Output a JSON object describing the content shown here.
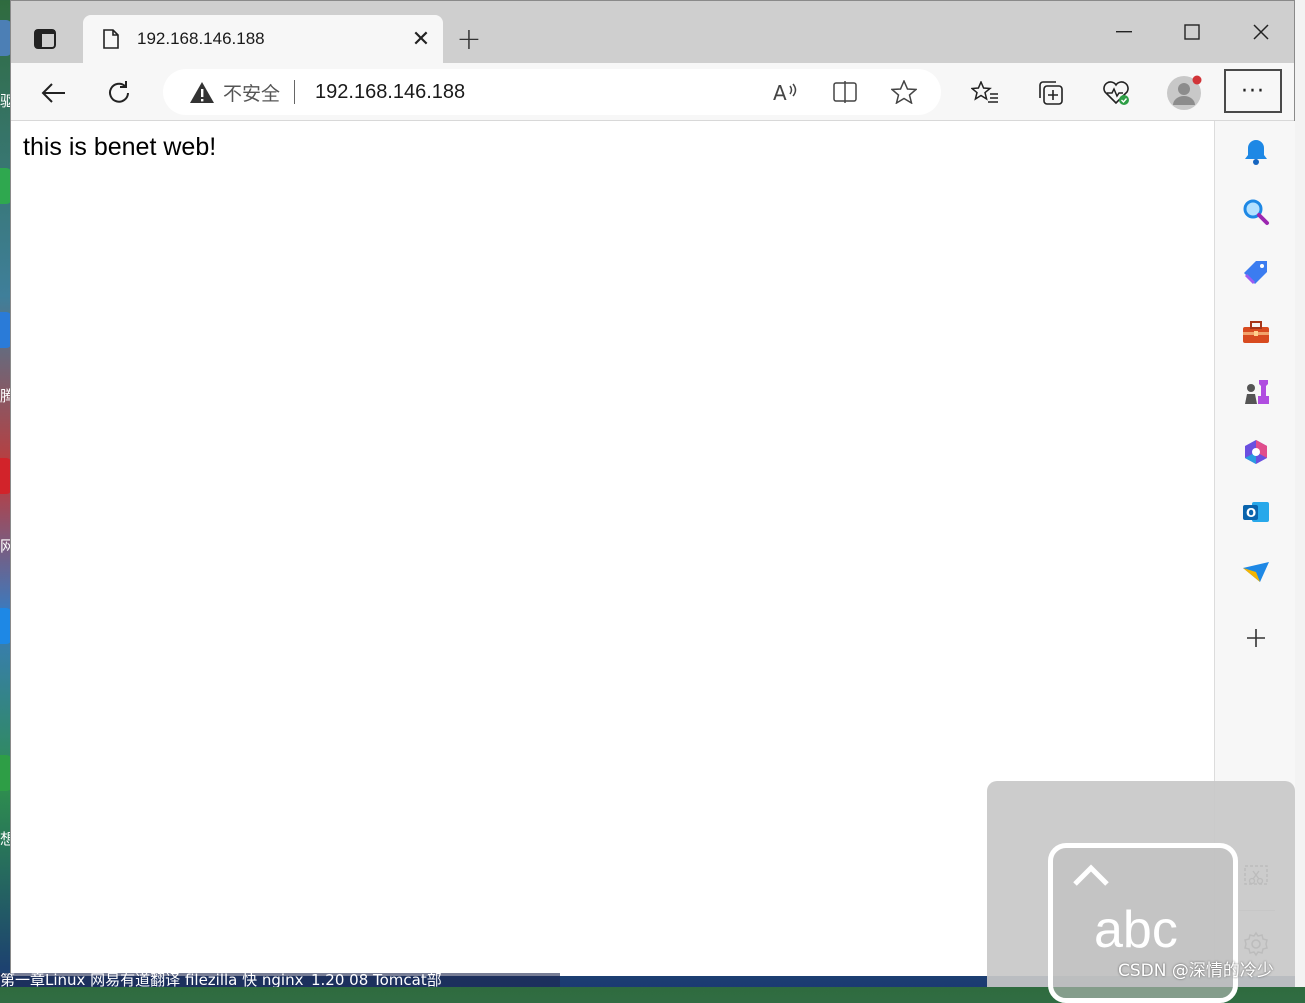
{
  "browser": {
    "tab": {
      "title": "192.168.146.188",
      "close_glyph": "✕"
    },
    "new_tab_glyph": "+",
    "window_controls": {
      "minimize": "—",
      "maximize": "☐",
      "close": "✕"
    },
    "address_bar": {
      "security_label": "不安全",
      "url": "192.168.146.188"
    },
    "more_menu_glyph": "···"
  },
  "page": {
    "body_text": "this is benet web!"
  },
  "sidebar": {
    "icons": [
      "bell-icon",
      "search-icon",
      "shopping-tag-icon",
      "toolbox-icon",
      "games-icon",
      "office-icon",
      "outlook-icon",
      "send-icon",
      "add-icon"
    ],
    "bottom_icons": [
      "screenshot-icon",
      "settings-icon"
    ]
  },
  "overlay": {
    "ime_label": "abc",
    "watermark": "CSDN @深情的冷少"
  },
  "desktop": {
    "taskbar_text": "第一章Linux  网易有道翻译  filezilla  快  nginx_1.20  08 Tomcat部",
    "left_labels": [
      "驱",
      "腾",
      "网",
      "想"
    ],
    "colors": {
      "window_bg": "#ffffff",
      "titlebar": "#cfcfcf",
      "toolbar": "#f7f7f7",
      "profile_dot": "#d13438"
    }
  }
}
